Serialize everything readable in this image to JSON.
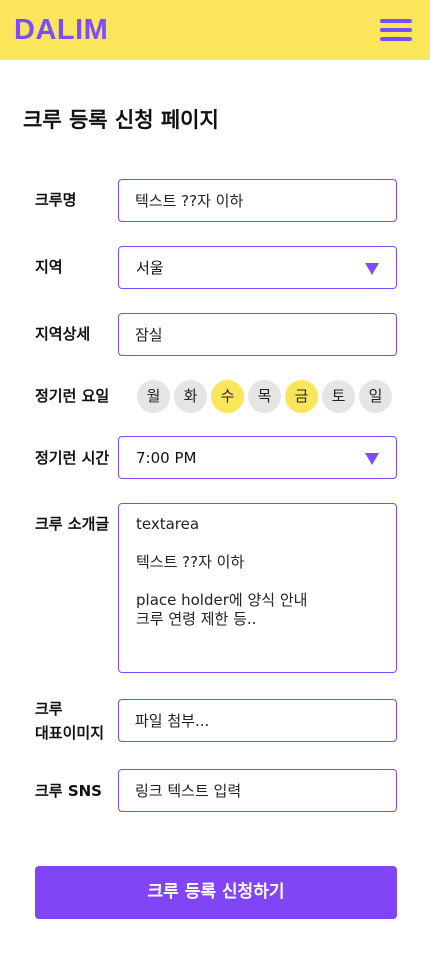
{
  "header": {
    "logo": "DALIM",
    "menu_icon": "hamburger-menu-icon",
    "logo_color": "#7c4dff",
    "bg_color": "#fbe55a"
  },
  "page": {
    "title": "크루 등록 신청 페이지"
  },
  "form": {
    "crew_name": {
      "label": "크루명",
      "placeholder": "텍스트 ??자 이하"
    },
    "region": {
      "label": "지역",
      "value": "서울",
      "icon": "dropdown-arrow-icon"
    },
    "region_detail": {
      "label": "지역상세",
      "placeholder": "잠실"
    },
    "weekday": {
      "label": "정기런 요일",
      "days": [
        {
          "label": "월",
          "selected": false
        },
        {
          "label": "화",
          "selected": false
        },
        {
          "label": "수",
          "selected": true
        },
        {
          "label": "목",
          "selected": false
        },
        {
          "label": "금",
          "selected": true
        },
        {
          "label": "토",
          "selected": false
        },
        {
          "label": "일",
          "selected": false
        }
      ]
    },
    "run_time": {
      "label": "정기런 시간",
      "value": "7:00 PM",
      "icon": "dropdown-arrow-icon"
    },
    "intro": {
      "label": "크루 소개글",
      "lines": [
        "textarea",
        "텍스트 ??자 이하",
        "place holder에 양식 안내",
        "크루 연령 제한 등.."
      ]
    },
    "image": {
      "label_line1": "크루",
      "label_line2": "대표이미지",
      "placeholder": "파일 첨부..."
    },
    "sns": {
      "label": "크루 SNS",
      "placeholder": "링크 텍스트 입력"
    },
    "submit_label": "크루 등록 신청하기"
  },
  "colors": {
    "accent": "#7c4dff",
    "button": "#8045f5",
    "highlight": "#fbe55a",
    "day_off": "#e5e5e5"
  }
}
